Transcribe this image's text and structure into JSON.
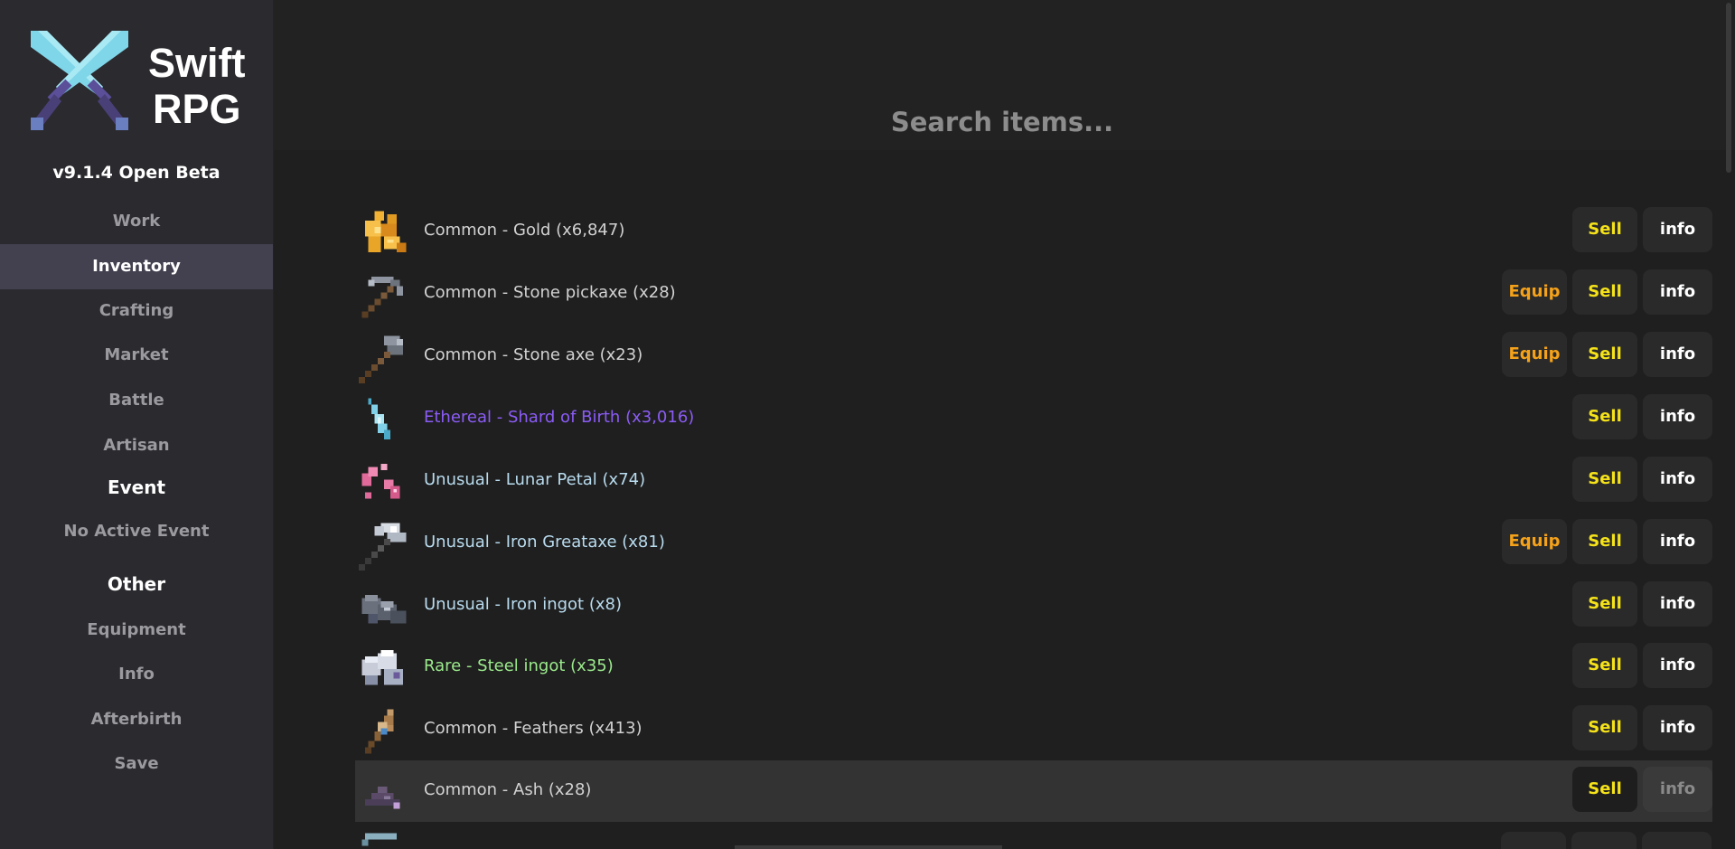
{
  "app": {
    "title_line1": "Swift",
    "title_line2": "RPG",
    "version": "v9.1.4 Open Beta"
  },
  "sidebar": {
    "nav": [
      "Work",
      "Inventory",
      "Crafting",
      "Market",
      "Battle",
      "Artisan"
    ],
    "active": "Inventory",
    "event_header": "Event",
    "event_status": "No Active Event",
    "other_header": "Other",
    "other": [
      "Equipment",
      "Info",
      "Afterbirth",
      "Save"
    ]
  },
  "search": {
    "placeholder": "Search items..."
  },
  "buttons": {
    "equip": "Equip",
    "sell": "Sell",
    "info": "info"
  },
  "colors": {
    "common": "#d2d2d2",
    "ethereal": "#8b5cf6",
    "unusual": "#b9dcef",
    "rare": "#9bea8c",
    "sell": "#f5e21a",
    "equip": "#f5a21a"
  },
  "inventory": [
    {
      "name": "Common - Gold (x6,847)",
      "rarity": "common",
      "icon": "gold-icon",
      "equip": false
    },
    {
      "name": "Common - Stone pickaxe (x28)",
      "rarity": "common",
      "icon": "pickaxe-icon",
      "equip": true
    },
    {
      "name": "Common - Stone axe (x23)",
      "rarity": "common",
      "icon": "axe-icon",
      "equip": true
    },
    {
      "name": "Ethereal - Shard of Birth (x3,016)",
      "rarity": "ethereal",
      "icon": "shard-icon",
      "equip": false
    },
    {
      "name": "Unusual - Lunar Petal (x74)",
      "rarity": "unusual",
      "icon": "petal-icon",
      "equip": false
    },
    {
      "name": "Unusual - Iron Greataxe (x81)",
      "rarity": "unusual",
      "icon": "greataxe-icon",
      "equip": true
    },
    {
      "name": "Unusual - Iron ingot (x8)",
      "rarity": "unusual",
      "icon": "iron-ingot-icon",
      "equip": false
    },
    {
      "name": "Rare - Steel ingot (x35)",
      "rarity": "rare",
      "icon": "steel-ingot-icon",
      "equip": false
    },
    {
      "name": "Common - Feathers (x413)",
      "rarity": "common",
      "icon": "feathers-icon",
      "equip": false
    },
    {
      "name": "Common - Ash (x28)",
      "rarity": "common",
      "icon": "ash-icon",
      "equip": false
    }
  ]
}
